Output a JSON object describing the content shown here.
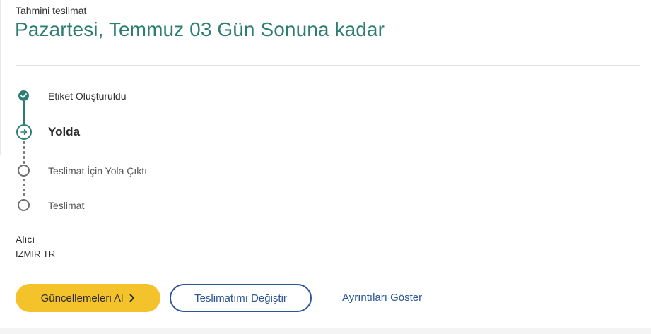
{
  "delivery": {
    "eta_label": "Tahmini teslimat",
    "eta_date": "Pazartesi, Temmuz 03 Gün Sonuna kadar"
  },
  "tracking": {
    "steps": [
      {
        "label": "Etiket Oluşturuldu",
        "state": "completed",
        "icon": "check-circle-icon"
      },
      {
        "label": "Yolda",
        "state": "current",
        "icon": "arrow-right-circle-icon"
      },
      {
        "label": "Teslimat İçin Yola Çıktı",
        "state": "pending",
        "icon": "empty-circle-icon"
      },
      {
        "label": "Teslimat",
        "state": "pending",
        "icon": "empty-circle-icon"
      }
    ]
  },
  "recipient": {
    "title": "Alıcı",
    "value": "IZMIR TR"
  },
  "actions": {
    "get_updates_label": "Güncellemeleri Al",
    "change_delivery_label": "Teslimatımı Değiştir",
    "show_details_label": "Ayrıntıları Göster"
  },
  "colors": {
    "accent_teal": "#2e7d73",
    "primary_button": "#f4c22b",
    "link_blue": "#2c5697"
  }
}
